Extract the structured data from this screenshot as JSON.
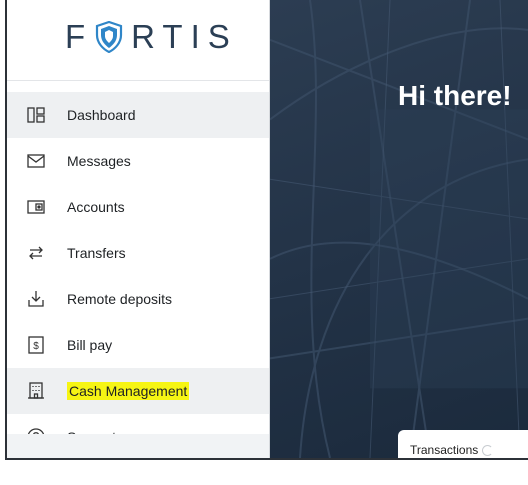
{
  "brand": {
    "logo_text_left": "F",
    "logo_text_right": "RTIS"
  },
  "sidebar": {
    "items": [
      {
        "label": "Dashboard",
        "icon": "dashboard-icon",
        "active": true
      },
      {
        "label": "Messages",
        "icon": "envelope-icon"
      },
      {
        "label": "Accounts",
        "icon": "wallet-icon"
      },
      {
        "label": "Transfers",
        "icon": "transfer-arrows-icon"
      },
      {
        "label": "Remote deposits",
        "icon": "deposit-icon"
      },
      {
        "label": "Bill pay",
        "icon": "dollar-bill-icon"
      },
      {
        "label": "Cash Management",
        "icon": "building-icon",
        "highlighted": true,
        "highlight_color": "#f6f514"
      },
      {
        "label": "Support",
        "icon": "help-circle-icon"
      }
    ]
  },
  "main": {
    "greeting": "Hi there!",
    "transactions_label": "Transactions"
  },
  "colors": {
    "brand_navy": "#2b3f55",
    "shield_blue": "#2f86c8",
    "hero_bg": "#223246",
    "highlight": "#f6f514"
  }
}
